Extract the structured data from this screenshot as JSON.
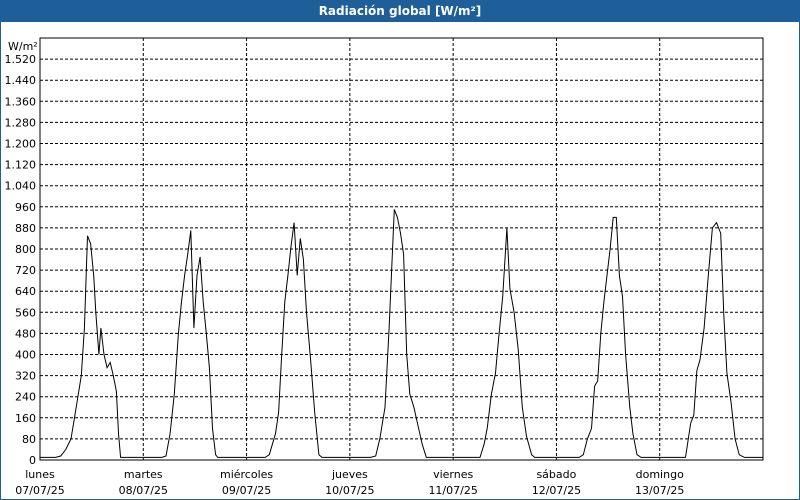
{
  "window": {
    "title": "Radiación global [W/m²]"
  },
  "chart_data": {
    "type": "line",
    "title": "Radiación global [W/m²]",
    "ylabel": "W/m²",
    "ylim": [
      0,
      1600
    ],
    "yticks": [
      0,
      80,
      160,
      240,
      320,
      400,
      480,
      560,
      640,
      720,
      800,
      880,
      960,
      1040,
      1120,
      1200,
      1280,
      1360,
      1440,
      1520
    ],
    "ytick_labels": [
      "0",
      "80",
      "160",
      "240",
      "320",
      "400",
      "480",
      "560",
      "640",
      "720",
      "800",
      "880",
      "960",
      "1.040",
      "1.120",
      "1.200",
      "1.280",
      "1.360",
      "1.440",
      "1.520"
    ],
    "xlim": [
      0,
      7
    ],
    "x_unit": "days from 07/07/25",
    "day_labels": [
      {
        "day": "lunes",
        "date": "07/07/25"
      },
      {
        "day": "martes",
        "date": "08/07/25"
      },
      {
        "day": "miércoles",
        "date": "09/07/25"
      },
      {
        "day": "jueves",
        "date": "10/07/25"
      },
      {
        "day": "viernes",
        "date": "11/07/25"
      },
      {
        "day": "sábado",
        "date": "12/07/25"
      },
      {
        "day": "domingo",
        "date": "13/07/25"
      }
    ],
    "grid": true,
    "series": [
      {
        "name": "",
        "color": "#000000",
        "points": [
          [
            0.0,
            10
          ],
          [
            0.15,
            10
          ],
          [
            0.2,
            15
          ],
          [
            0.25,
            40
          ],
          [
            0.3,
            80
          ],
          [
            0.35,
            200
          ],
          [
            0.4,
            320
          ],
          [
            0.43,
            500
          ],
          [
            0.46,
            850
          ],
          [
            0.49,
            820
          ],
          [
            0.52,
            700
          ],
          [
            0.54,
            560
          ],
          [
            0.57,
            400
          ],
          [
            0.59,
            500
          ],
          [
            0.62,
            400
          ],
          [
            0.65,
            350
          ],
          [
            0.68,
            370
          ],
          [
            0.71,
            320
          ],
          [
            0.74,
            260
          ],
          [
            0.76,
            100
          ],
          [
            0.78,
            10
          ],
          [
            1.0,
            10
          ],
          [
            1.0,
            10
          ],
          [
            1.18,
            10
          ],
          [
            1.22,
            15
          ],
          [
            1.26,
            100
          ],
          [
            1.3,
            250
          ],
          [
            1.34,
            480
          ],
          [
            1.37,
            600
          ],
          [
            1.4,
            700
          ],
          [
            1.43,
            780
          ],
          [
            1.46,
            870
          ],
          [
            1.49,
            500
          ],
          [
            1.52,
            700
          ],
          [
            1.55,
            770
          ],
          [
            1.58,
            600
          ],
          [
            1.61,
            480
          ],
          [
            1.64,
            350
          ],
          [
            1.67,
            120
          ],
          [
            1.7,
            20
          ],
          [
            1.72,
            10
          ],
          [
            2.0,
            10
          ],
          [
            2.0,
            10
          ],
          [
            2.18,
            10
          ],
          [
            2.22,
            20
          ],
          [
            2.25,
            60
          ],
          [
            2.28,
            100
          ],
          [
            2.31,
            180
          ],
          [
            2.34,
            400
          ],
          [
            2.37,
            600
          ],
          [
            2.4,
            700
          ],
          [
            2.43,
            810
          ],
          [
            2.46,
            900
          ],
          [
            2.49,
            700
          ],
          [
            2.52,
            840
          ],
          [
            2.55,
            760
          ],
          [
            2.58,
            560
          ],
          [
            2.62,
            380
          ],
          [
            2.66,
            180
          ],
          [
            2.7,
            20
          ],
          [
            2.73,
            10
          ],
          [
            3.0,
            10
          ],
          [
            3.0,
            10
          ],
          [
            3.2,
            10
          ],
          [
            3.25,
            15
          ],
          [
            3.29,
            80
          ],
          [
            3.34,
            200
          ],
          [
            3.38,
            500
          ],
          [
            3.43,
            950
          ],
          [
            3.46,
            920
          ],
          [
            3.49,
            860
          ],
          [
            3.52,
            780
          ],
          [
            3.55,
            400
          ],
          [
            3.58,
            250
          ],
          [
            3.62,
            200
          ],
          [
            3.66,
            130
          ],
          [
            3.7,
            60
          ],
          [
            3.74,
            10
          ],
          [
            4.0,
            10
          ],
          [
            4.0,
            10
          ],
          [
            4.26,
            10
          ],
          [
            4.3,
            60
          ],
          [
            4.33,
            120
          ],
          [
            4.37,
            250
          ],
          [
            4.41,
            330
          ],
          [
            4.44,
            460
          ],
          [
            4.48,
            620
          ],
          [
            4.52,
            880
          ],
          [
            4.55,
            650
          ],
          [
            4.59,
            560
          ],
          [
            4.63,
            420
          ],
          [
            4.67,
            200
          ],
          [
            4.71,
            90
          ],
          [
            4.76,
            20
          ],
          [
            4.79,
            10
          ],
          [
            5.0,
            10
          ],
          [
            5.0,
            10
          ],
          [
            5.22,
            10
          ],
          [
            5.26,
            20
          ],
          [
            5.3,
            80
          ],
          [
            5.34,
            120
          ],
          [
            5.37,
            280
          ],
          [
            5.4,
            300
          ],
          [
            5.43,
            480
          ],
          [
            5.46,
            600
          ],
          [
            5.49,
            700
          ],
          [
            5.52,
            800
          ],
          [
            5.55,
            920
          ],
          [
            5.58,
            920
          ],
          [
            5.61,
            700
          ],
          [
            5.64,
            620
          ],
          [
            5.67,
            400
          ],
          [
            5.71,
            200
          ],
          [
            5.74,
            100
          ],
          [
            5.78,
            20
          ],
          [
            5.82,
            10
          ],
          [
            6.0,
            10
          ],
          [
            6.0,
            10
          ],
          [
            6.25,
            10
          ],
          [
            6.3,
            140
          ],
          [
            6.33,
            170
          ],
          [
            6.36,
            340
          ],
          [
            6.39,
            380
          ],
          [
            6.43,
            500
          ],
          [
            6.47,
            700
          ],
          [
            6.51,
            880
          ],
          [
            6.55,
            900
          ],
          [
            6.59,
            860
          ],
          [
            6.62,
            550
          ],
          [
            6.65,
            330
          ],
          [
            6.69,
            220
          ],
          [
            6.73,
            80
          ],
          [
            6.77,
            20
          ],
          [
            6.82,
            10
          ],
          [
            7.0,
            10
          ]
        ]
      }
    ]
  }
}
